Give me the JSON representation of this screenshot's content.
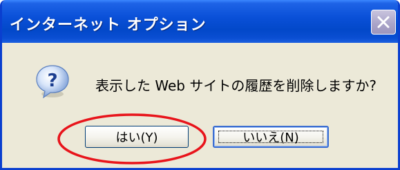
{
  "window": {
    "title": "インターネット オプション",
    "close_icon": "close-icon"
  },
  "dialog": {
    "icon": "question-icon",
    "message": "表示した Web サイトの履歴を削除しますか?"
  },
  "buttons": {
    "yes_label": "はい(Y)",
    "no_label": "いいえ(N)"
  },
  "annotation": {
    "highlight_color": "#e8141b"
  },
  "colors": {
    "titlebar": "#0a50d8",
    "window_bg": "#ece9d8"
  }
}
